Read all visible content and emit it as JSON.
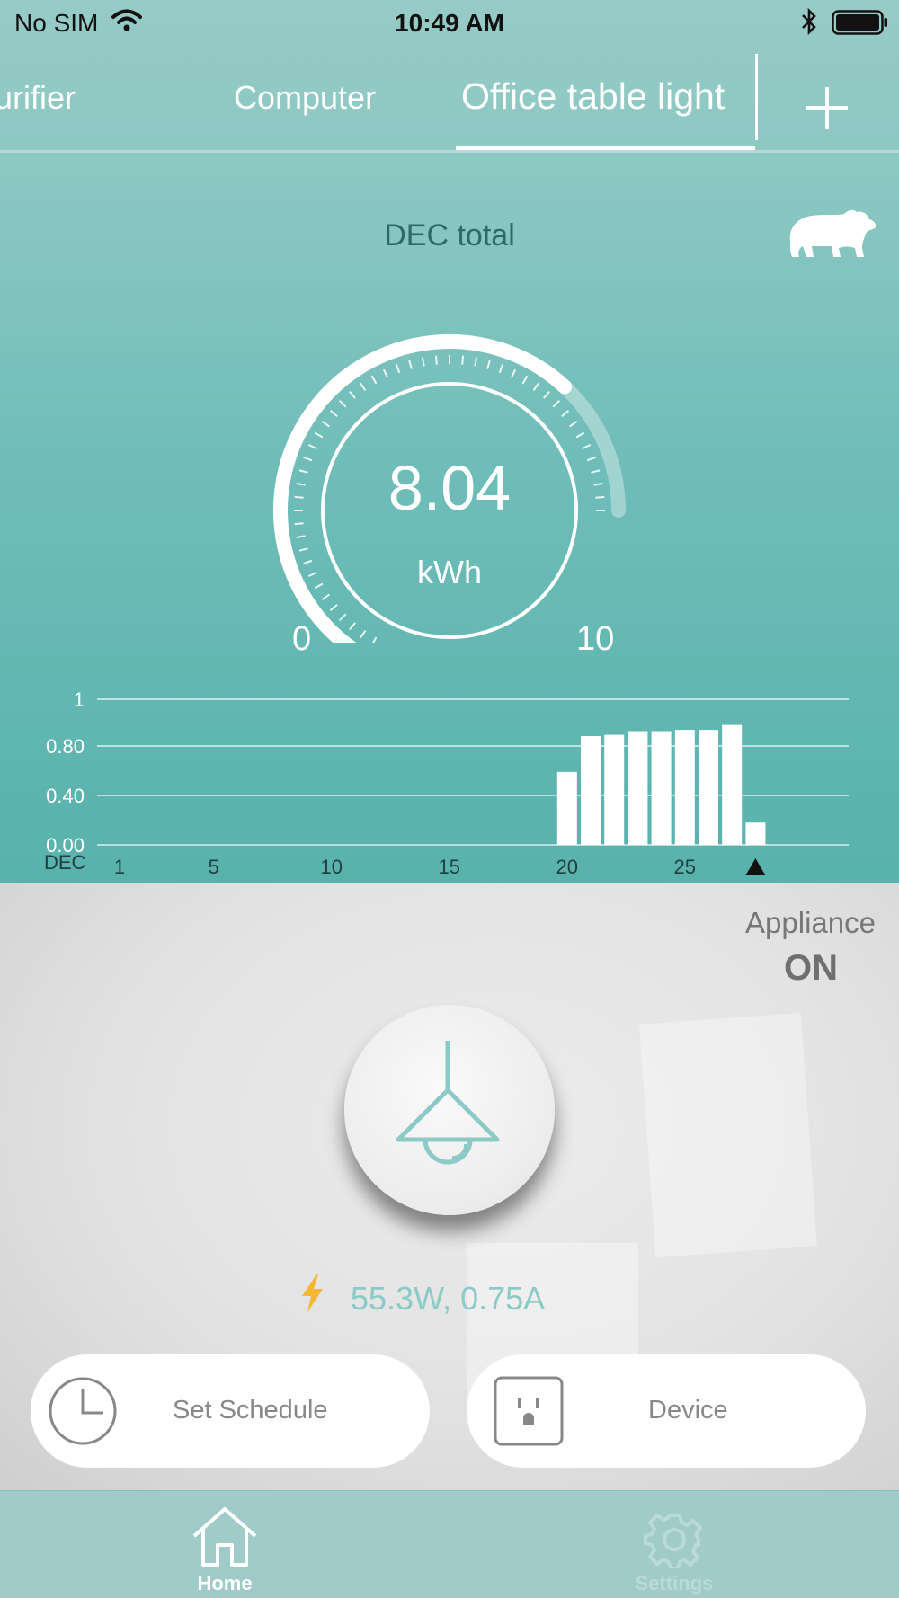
{
  "status_bar": {
    "carrier": "No SIM",
    "time": "10:49 AM"
  },
  "tabs": {
    "items": [
      "urifier",
      "Computer",
      "Office table light"
    ],
    "active_index": 2
  },
  "summary": {
    "title": "DEC total"
  },
  "gauge": {
    "value": "8.04",
    "unit": "kWh",
    "min_label": "0",
    "max_label": "10",
    "fill_fraction": 0.804
  },
  "chart_data": {
    "type": "bar",
    "x_axis_label": "DEC",
    "x_tick_labels": [
      "1",
      "5",
      "10",
      "15",
      "20",
      "25"
    ],
    "y_tick_labels": [
      "1",
      "0.80",
      "0.40",
      "0.00"
    ],
    "ylim": [
      0,
      1.2
    ],
    "days": [
      20,
      21,
      22,
      23,
      24,
      25,
      26,
      27,
      28
    ],
    "values": [
      0.59,
      0.88,
      0.89,
      0.92,
      0.92,
      0.93,
      0.93,
      0.97,
      0.18
    ],
    "current_day_marker": 28,
    "grid": true
  },
  "appliance": {
    "label": "Appliance",
    "state": "ON"
  },
  "power": {
    "reading": "55.3W, 0.75A"
  },
  "actions": {
    "schedule_label": "Set Schedule",
    "device_label": "Device"
  },
  "tabbar": {
    "home_label": "Home",
    "settings_label": "Settings"
  },
  "colors": {
    "accent": "#5fb5af",
    "icon_teal": "#8ccac6",
    "bolt": "#f3b731"
  }
}
